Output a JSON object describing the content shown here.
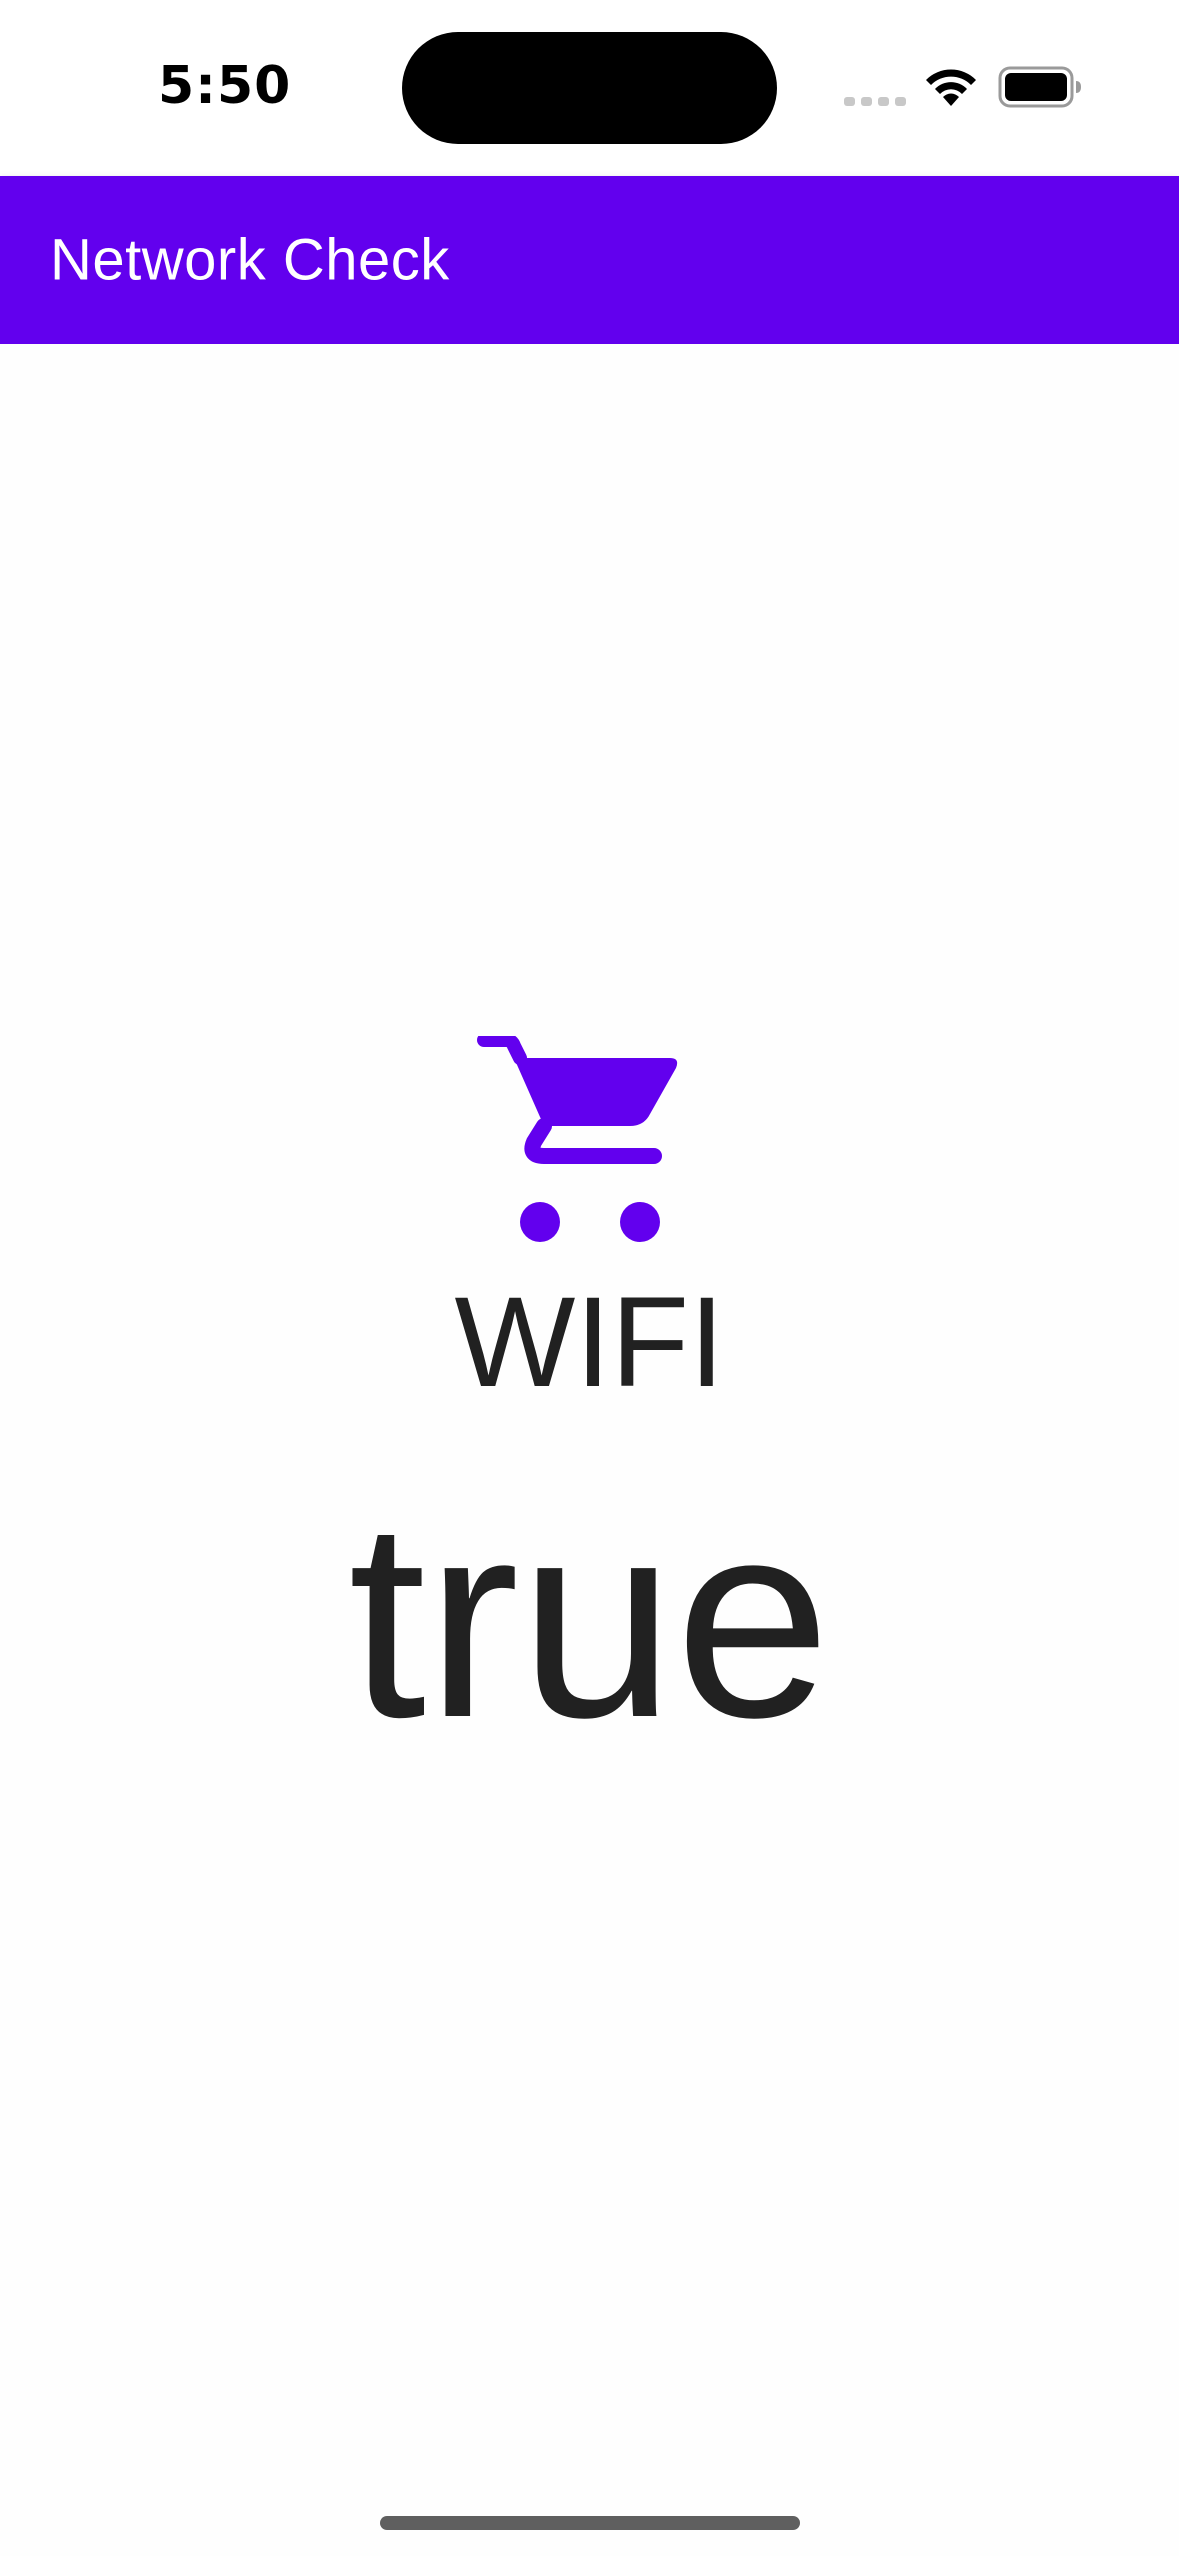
{
  "status_bar": {
    "time": "5:50",
    "icons": [
      "cellular-signal-icon",
      "wifi-icon",
      "battery-icon"
    ]
  },
  "app_bar": {
    "title": "Network Check"
  },
  "connection": {
    "icon": "shopping-cart-icon",
    "type_label": "WIFI",
    "status_value": "true"
  },
  "colors": {
    "primary": "#6200EE",
    "text": "#212121",
    "background": "#FEFEFE"
  }
}
